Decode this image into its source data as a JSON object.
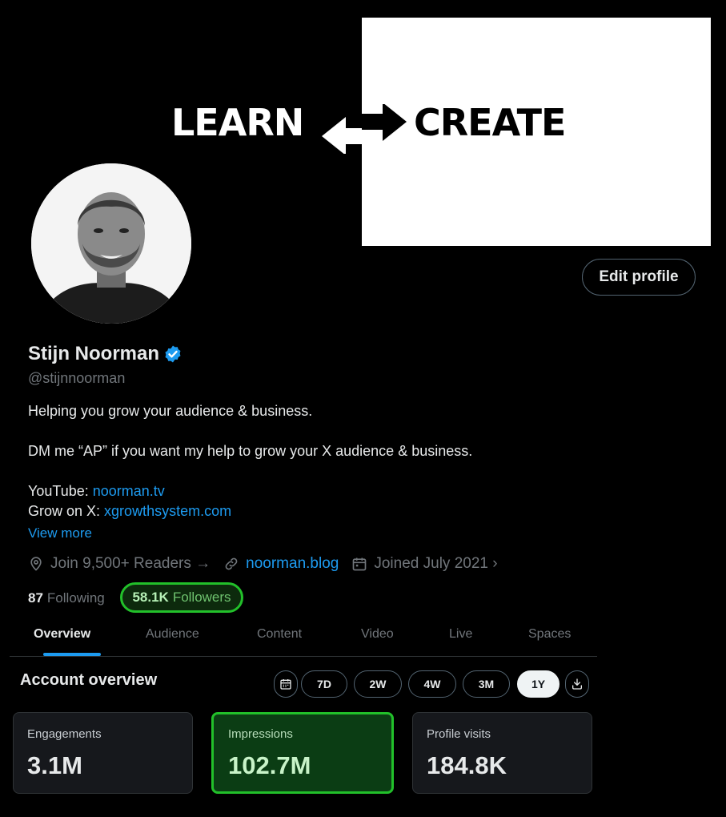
{
  "banner": {
    "left_word": "LEARN",
    "right_word": "CREATE"
  },
  "profile": {
    "edit_label": "Edit profile",
    "name": "Stijn Noorman",
    "handle": "@stijnnoorman",
    "bio_line1": "Helping you grow your audience & business.",
    "bio_line2": "DM me “AP” if you want my help to grow your X audience & business.",
    "youtube_label": "YouTube: ",
    "youtube_link": "noorman.tv",
    "grow_label": "Grow on X: ",
    "grow_link": "xgrowthsystem.com",
    "view_more": "View more",
    "meta": {
      "readers": "Join 9,500+ Readers →",
      "blog": "noorman.blog",
      "joined": "Joined July 2021 ›"
    },
    "following_count": "87",
    "following_label": "Following",
    "followers_count": "58.1K",
    "followers_label": "Followers"
  },
  "tabs": [
    {
      "label": "Overview"
    },
    {
      "label": "Audience"
    },
    {
      "label": "Content"
    },
    {
      "label": "Video"
    },
    {
      "label": "Live"
    },
    {
      "label": "Spaces"
    }
  ],
  "overview": {
    "title": "Account overview",
    "ranges": [
      "7D",
      "2W",
      "4W",
      "3M",
      "1Y"
    ],
    "selected_range": "1Y"
  },
  "cards": [
    {
      "label": "Engagements",
      "value": "3.1M"
    },
    {
      "label": "Impressions",
      "value": "102.7M"
    },
    {
      "label": "Profile visits",
      "value": "184.8K"
    }
  ],
  "colors": {
    "accent_blue": "#1d9bf0",
    "highlight_green": "#22c02a"
  }
}
